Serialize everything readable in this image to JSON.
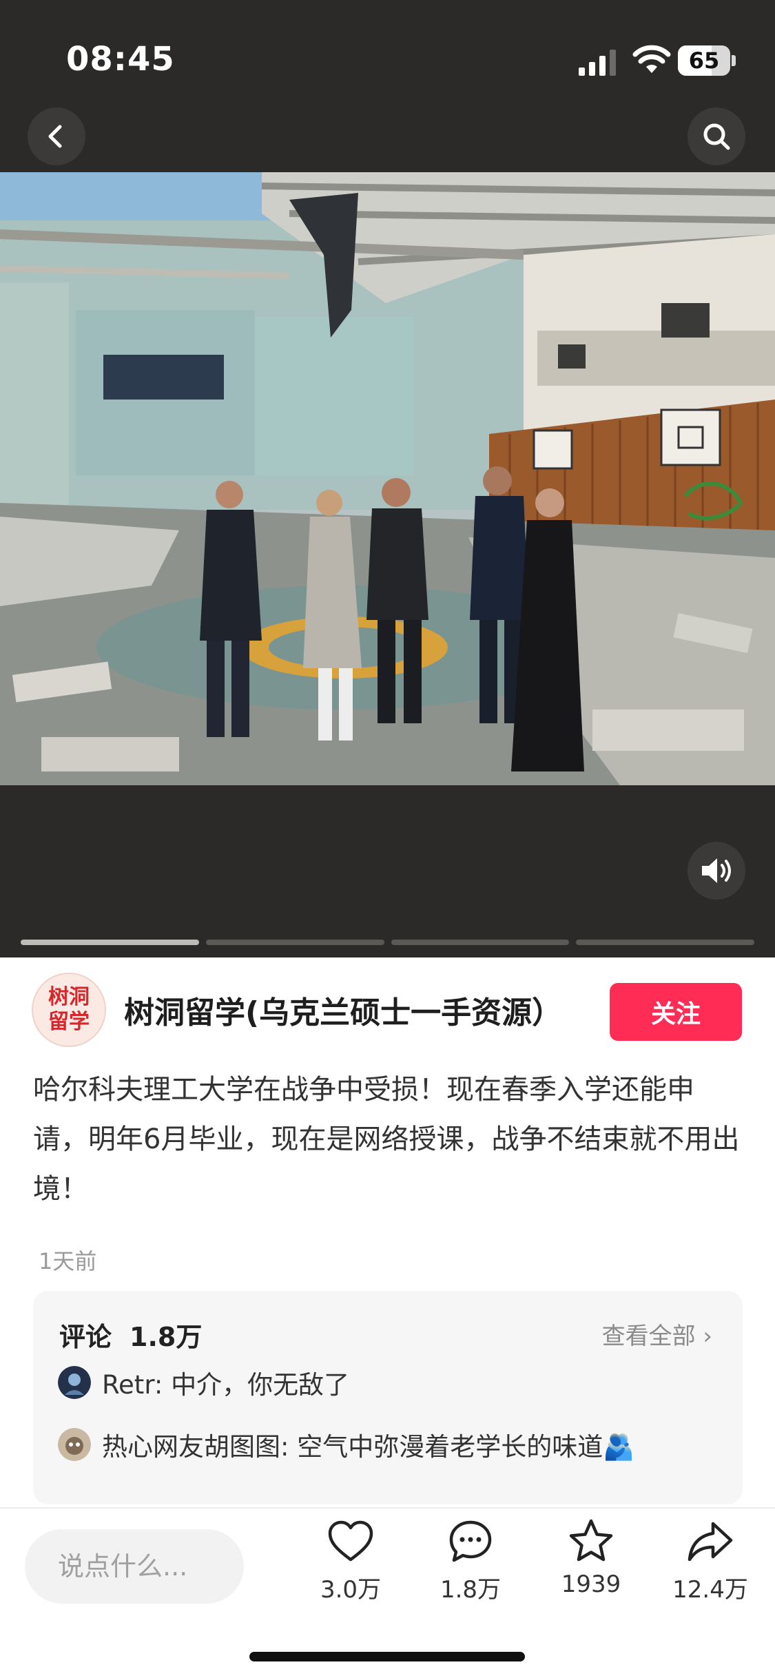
{
  "status_bar": {
    "time": "08:45",
    "battery": "65",
    "battery_level": 0.65
  },
  "nav": {
    "back_icon": "chevron-left-icon",
    "search_icon": "search-icon"
  },
  "media": {
    "sound_icon": "speaker-icon",
    "slide_count": 4,
    "active_slide": 0
  },
  "author": {
    "avatar_line1": "树洞",
    "avatar_line2": "留学",
    "name": "树洞留学(乌克兰硕士一手资源）",
    "follow_label": "关注"
  },
  "post": {
    "text": "哈尔科夫理工大学在战争中受损！现在春季入学还能申请，明年6月毕业，现在是网络授课，战争不结束就不用出境！",
    "time": "1天前"
  },
  "comments": {
    "title": "评论",
    "count": "1.8万",
    "view_all": "查看全部 ›",
    "items": [
      {
        "text": "Retr: 中介，你无敌了"
      },
      {
        "text": "热心网友胡图图: 空气中弥漫着老学长的味道🫂"
      }
    ]
  },
  "bottom_bar": {
    "input_placeholder": "说点什么...",
    "like_count": "3.0万",
    "comment_count": "1.8万",
    "star_count": "1939",
    "share_count": "12.4万"
  },
  "colors": {
    "accent": "#ff2c55",
    "dark_bg": "#2b2a28"
  }
}
